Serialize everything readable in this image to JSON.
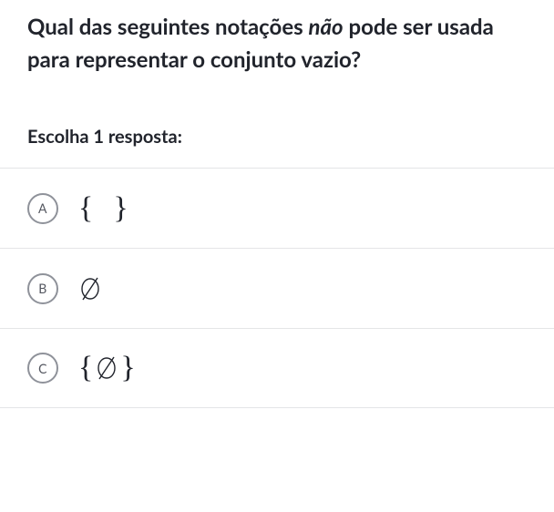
{
  "question": {
    "pre": "Qual das seguintes notações ",
    "em": "não",
    "post": " pode ser usada para representar o conjunto vazio?"
  },
  "instruction": "Escolha 1 resposta:",
  "options": [
    {
      "letter": "A",
      "type": "braces-empty"
    },
    {
      "letter": "B",
      "type": "emptyset"
    },
    {
      "letter": "C",
      "type": "braces-emptyset"
    }
  ]
}
